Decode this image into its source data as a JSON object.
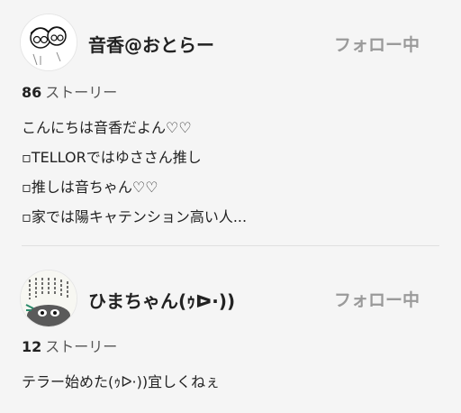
{
  "users": [
    {
      "name": "音香@おとらー",
      "follow_label": "フォロー中",
      "story_count": "86",
      "story_label": "ストーリー",
      "bio_lines": [
        "こんにちは音香だよん♡♡",
        "▫TELLORではゆささん推し",
        "▫推しは音ちゃん♡♡",
        "▫家では陽キャテンション高い人..."
      ]
    },
    {
      "name": "ひまちゃん(ｩᐅ·))",
      "follow_label": "フォロー中",
      "story_count": "12",
      "story_label": "ストーリー",
      "bio_lines": [
        "テラー始めた(ｩᐅ·))宜しくねぇ"
      ]
    }
  ]
}
